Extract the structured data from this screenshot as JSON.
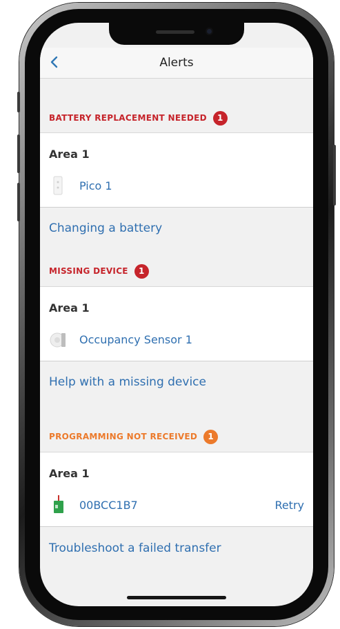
{
  "header": {
    "title": "Alerts",
    "back_icon": "chevron-left-icon"
  },
  "sections": [
    {
      "heading": "BATTERY REPLACEMENT NEEDED",
      "count": "1",
      "color": "#c6242b",
      "area": "Area 1",
      "device": {
        "name": "Pico 1",
        "icon": "pico-remote-icon"
      },
      "help": "Changing a battery"
    },
    {
      "heading": "MISSING DEVICE",
      "count": "1",
      "color": "#c6242b",
      "area": "Area 1",
      "device": {
        "name": "Occupancy Sensor 1",
        "icon": "occupancy-sensor-icon"
      },
      "help": "Help with a missing device"
    },
    {
      "heading": "PROGRAMMING NOT RECEIVED",
      "count": "1",
      "color": "#ec7a2b",
      "area": "Area 1",
      "device": {
        "name": "00BCC1B7",
        "icon": "module-icon",
        "action": "Retry"
      },
      "help": "Troubleshoot a failed transfer"
    }
  ],
  "colors": {
    "link": "#2f6fb0",
    "alert_red": "#c6242b",
    "alert_orange": "#ec7a2b"
  }
}
